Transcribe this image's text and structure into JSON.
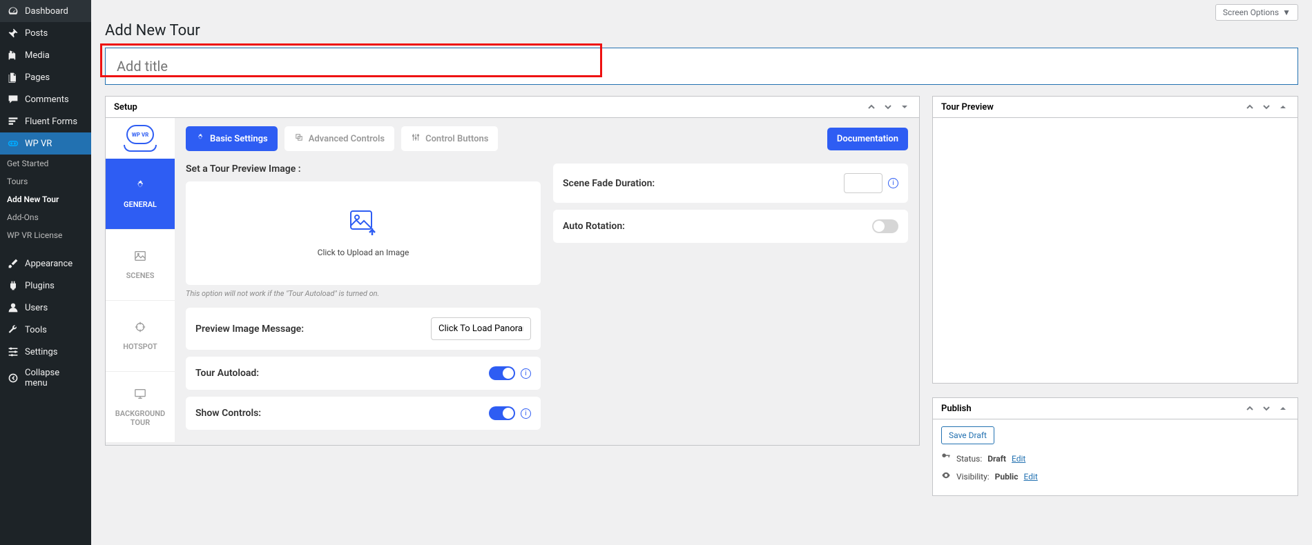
{
  "sidebar": {
    "items": [
      {
        "label": "Dashboard",
        "icon": "gauge-icon"
      },
      {
        "label": "Posts",
        "icon": "pin-icon"
      },
      {
        "label": "Media",
        "icon": "media-icon"
      },
      {
        "label": "Pages",
        "icon": "pages-icon"
      },
      {
        "label": "Comments",
        "icon": "comments-icon"
      },
      {
        "label": "Fluent Forms",
        "icon": "forms-icon"
      },
      {
        "label": "WP VR",
        "icon": "wpvr-icon",
        "active": true
      }
    ],
    "subitems": [
      {
        "label": "Get Started"
      },
      {
        "label": "Tours"
      },
      {
        "label": "Add New Tour",
        "active": true
      },
      {
        "label": "Add-Ons"
      },
      {
        "label": "WP VR License"
      }
    ],
    "items2": [
      {
        "label": "Appearance",
        "icon": "brush-icon"
      },
      {
        "label": "Plugins",
        "icon": "plug-icon"
      },
      {
        "label": "Users",
        "icon": "user-icon"
      },
      {
        "label": "Tools",
        "icon": "wrench-icon"
      },
      {
        "label": "Settings",
        "icon": "sliders-icon"
      },
      {
        "label": "Collapse menu",
        "icon": "collapse-icon"
      }
    ]
  },
  "screen_options_label": "Screen Options",
  "page_title": "Add New Tour",
  "title_placeholder": "Add title",
  "setup": {
    "header": "Setup",
    "vtabs": [
      {
        "label": "GENERAL",
        "active": true
      },
      {
        "label": "SCENES"
      },
      {
        "label": "HOTSPOT"
      },
      {
        "label": "BACKGROUND TOUR"
      }
    ],
    "toolbar": {
      "basic": "Basic Settings",
      "advanced": "Advanced Controls",
      "control": "Control Buttons",
      "doc": "Documentation"
    },
    "preview_label": "Set a Tour Preview Image :",
    "upload_text": "Click to Upload an Image",
    "hint": "This option will not work if the \"Tour Autoload\" is turned on.",
    "preview_msg_label": "Preview Image Message:",
    "preview_msg_value": "Click To Load Panoram",
    "autoload_label": "Tour Autoload:",
    "show_controls_label": "Show Controls:",
    "fade_label": "Scene Fade Duration:",
    "rotation_label": "Auto Rotation:"
  },
  "tour_preview": {
    "header": "Tour Preview"
  },
  "publish": {
    "header": "Publish",
    "save_draft": "Save Draft",
    "status_label": "Status:",
    "status_value": "Draft",
    "visibility_label": "Visibility:",
    "visibility_value": "Public",
    "edit": "Edit"
  }
}
